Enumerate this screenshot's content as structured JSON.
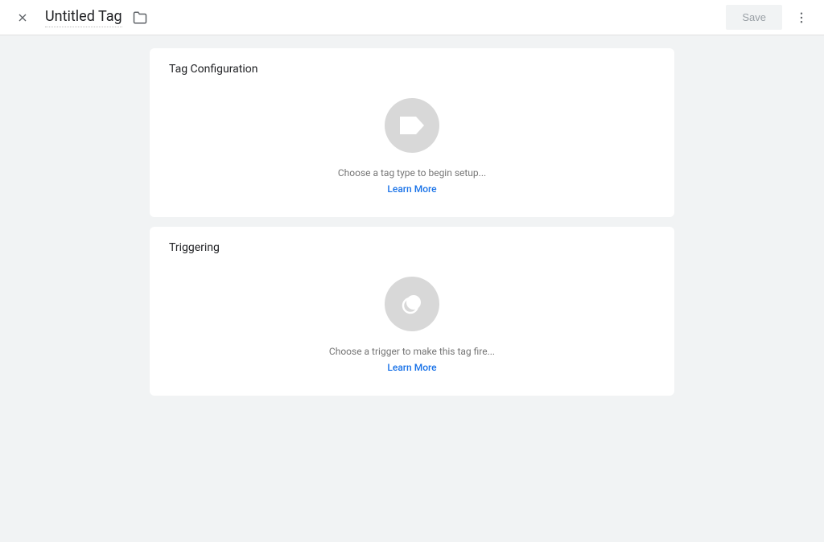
{
  "header": {
    "title": "Untitled Tag",
    "save_label": "Save"
  },
  "tag_config": {
    "title": "Tag Configuration",
    "prompt": "Choose a tag type to begin setup...",
    "learn_more": "Learn More"
  },
  "triggering": {
    "title": "Triggering",
    "prompt": "Choose a trigger to make this tag fire...",
    "learn_more": "Learn More"
  }
}
